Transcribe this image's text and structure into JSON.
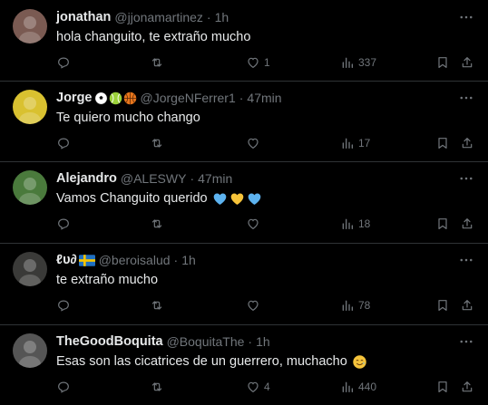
{
  "replies": [
    {
      "name": "jonathan",
      "handle": "@jjonamartinez",
      "time": "1h",
      "text": "hola changuito, te extraño mucho",
      "replies": "",
      "reposts": "",
      "likes": "1",
      "views": "337",
      "avatar_color": "#7a5a52",
      "badges": [],
      "text_emojis": []
    },
    {
      "name": "Jorge",
      "handle": "@JorgeNFerrer1",
      "time": "47min",
      "text": "Te quiero mucho chango",
      "replies": "",
      "reposts": "",
      "likes": "",
      "views": "17",
      "avatar_color": "#d9c130",
      "badges": [
        "soccer-ball",
        "tennis-ball",
        "basketball"
      ],
      "text_emojis": []
    },
    {
      "name": "Alejandro",
      "handle": "@ALESWY",
      "time": "47min",
      "text": "Vamos Changuito querido",
      "replies": "",
      "reposts": "",
      "likes": "",
      "views": "18",
      "avatar_color": "#4a7a3c",
      "badges": [],
      "text_emojis": [
        "blue-heart",
        "yellow-heart",
        "blue-heart"
      ]
    },
    {
      "name": "ℓυ∂",
      "handle": "@beroisalud",
      "time": "1h",
      "text": "te extraño mucho",
      "replies": "",
      "reposts": "",
      "likes": "",
      "views": "78",
      "avatar_color": "#3a3a38",
      "badges": [
        "sweden-flag"
      ],
      "text_emojis": []
    },
    {
      "name": "TheGoodBoquita",
      "handle": "@BoquitaThe",
      "time": "1h",
      "text": "Esas son las cicatrices de un guerrero, muchacho",
      "replies": "",
      "reposts": "",
      "likes": "4",
      "views": "440",
      "avatar_color": "#555555",
      "badges": [],
      "text_emojis": [
        "smiling-tear-face"
      ]
    }
  ],
  "colors": {
    "background": "#000000",
    "text": "#e7e9ea",
    "muted": "#71767b",
    "divider": "#2f3336"
  }
}
